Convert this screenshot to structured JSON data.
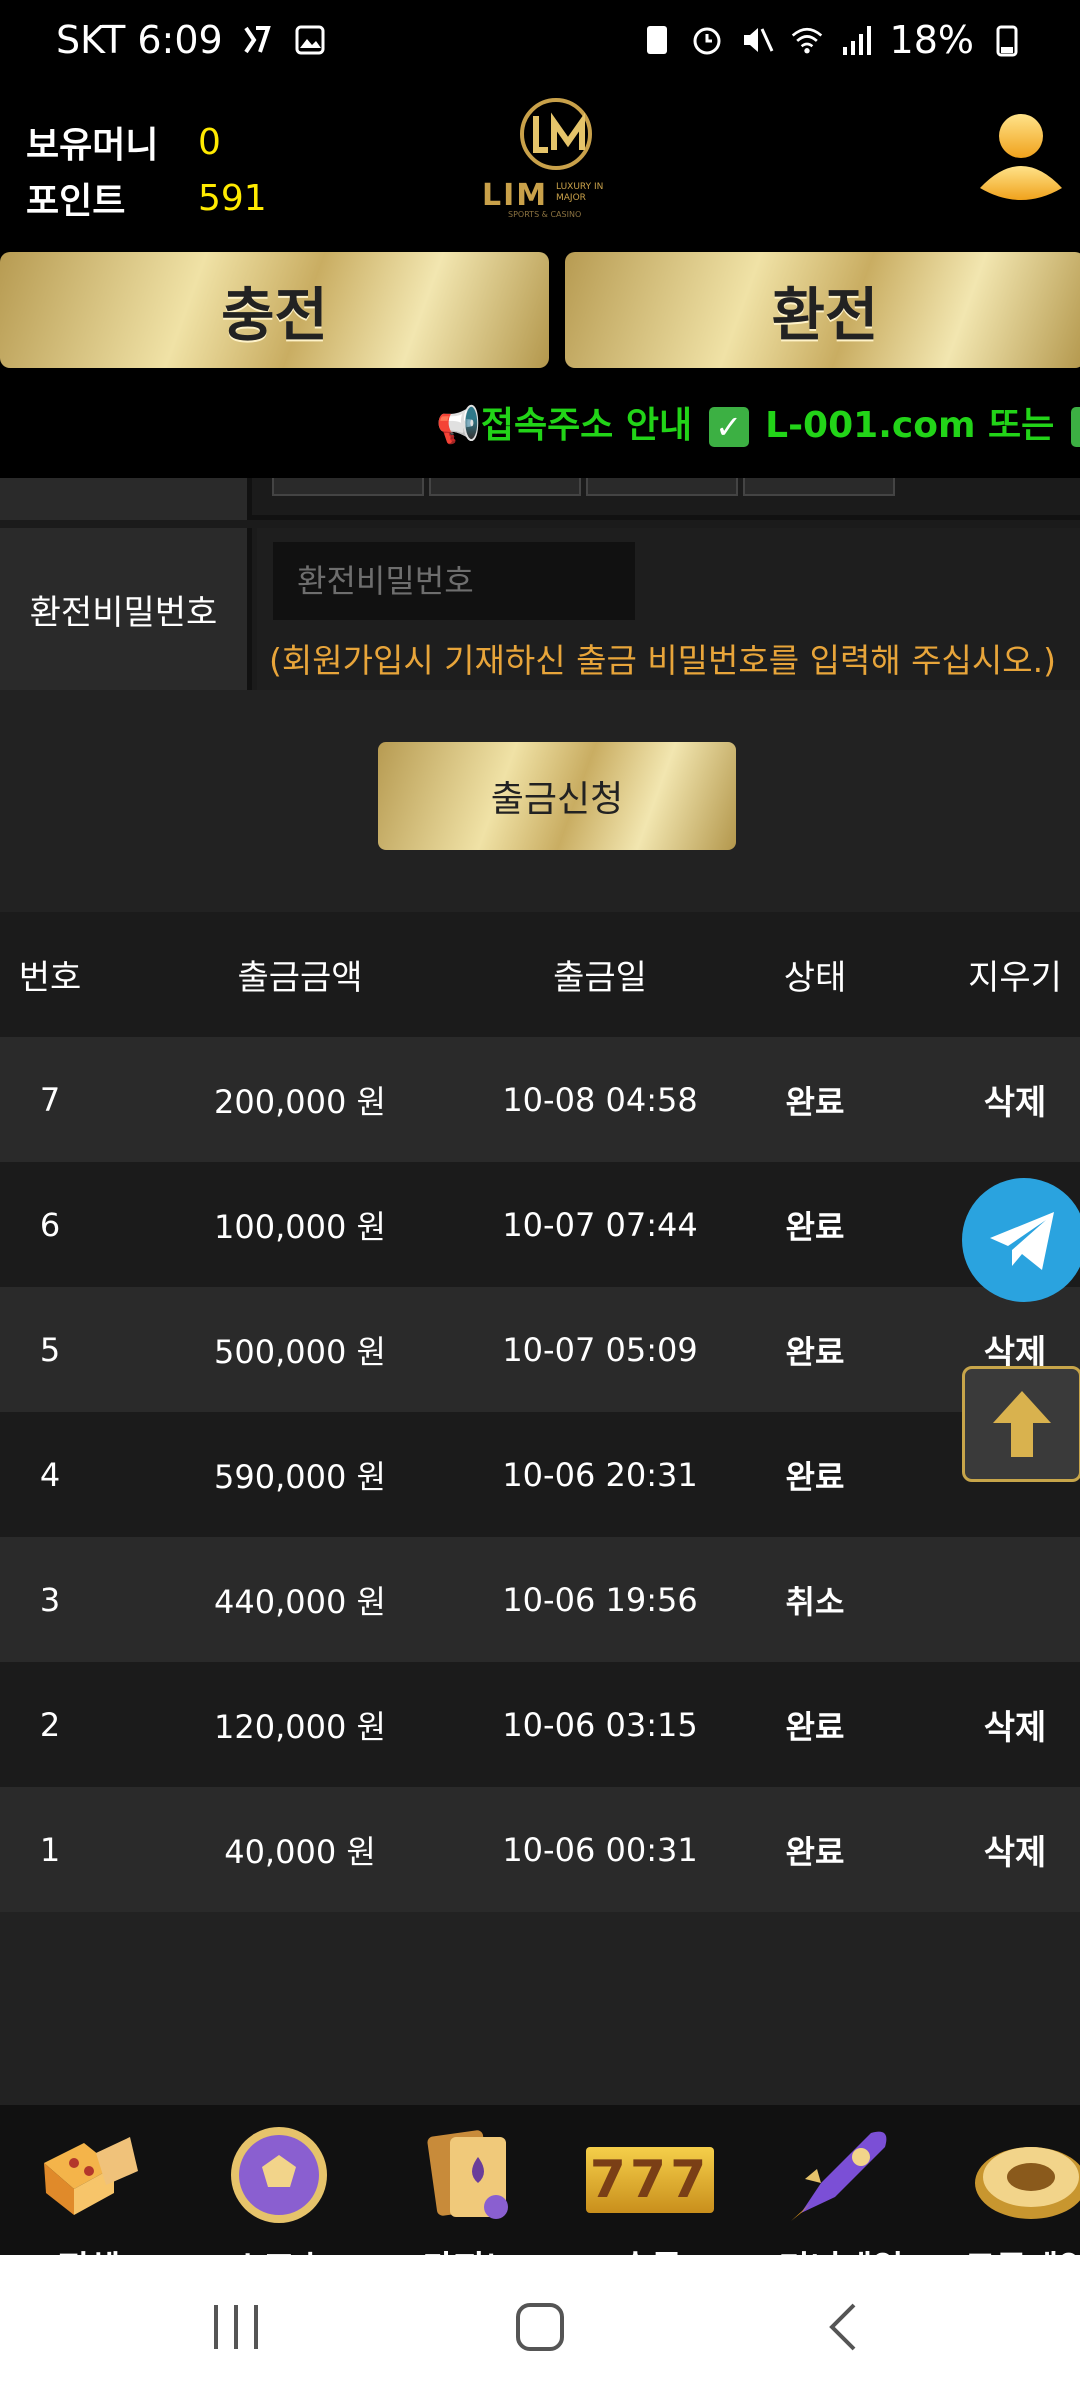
{
  "status_bar": {
    "carrier_time": "SKT 6:09",
    "battery": "18%"
  },
  "header": {
    "money_label": "보유머니",
    "money_value": "0",
    "points_label": "포인트",
    "points_value": "591",
    "logo_text": "LIM",
    "logo_sub": "LUXURY IN MAJOR",
    "logo_tag": "SPORTS & CASINO"
  },
  "actions": {
    "charge_label": "충전",
    "exchange_label": "환전"
  },
  "ticker": {
    "text_a": "📢접속주소 안내",
    "text_b": "L-001.com 또는"
  },
  "form": {
    "password_label": "환전비밀번호",
    "password_placeholder": "환전비밀번호",
    "password_note": "(회원가입시 기재하신 출금 비밀번호를 입력해 주십시오.)",
    "submit_label": "출금신청"
  },
  "table": {
    "headers": [
      "번호",
      "출금금액",
      "출금일",
      "상태",
      "지우기"
    ],
    "rows": [
      {
        "no": "7",
        "amount": "200,000 원",
        "date": "10-08 04:58",
        "status": "완료",
        "delete": "삭제"
      },
      {
        "no": "6",
        "amount": "100,000 원",
        "date": "10-07 07:44",
        "status": "완료",
        "delete": ""
      },
      {
        "no": "5",
        "amount": "500,000 원",
        "date": "10-07 05:09",
        "status": "완료",
        "delete": "삭제"
      },
      {
        "no": "4",
        "amount": "590,000 원",
        "date": "10-06 20:31",
        "status": "완료",
        "delete": ""
      },
      {
        "no": "3",
        "amount": "440,000 원",
        "date": "10-06 19:56",
        "status": "취소",
        "delete": ""
      },
      {
        "no": "2",
        "amount": "120,000 원",
        "date": "10-06 03:15",
        "status": "완료",
        "delete": "삭제"
      },
      {
        "no": "1",
        "amount": "40,000 원",
        "date": "10-06 00:31",
        "status": "완료",
        "delete": "삭제"
      }
    ]
  },
  "game_nav": {
    "items": [
      "전체",
      "스포츠",
      "카지노",
      "슬롯",
      "미니게임",
      "토큰게임"
    ],
    "slot_text": "777"
  },
  "colors": {
    "gold": "#e8d49a",
    "money_yellow": "#ffea00",
    "note_orange": "#e8a53a",
    "ticker_green": "#22d418",
    "telegram_blue": "#2aa3df"
  }
}
